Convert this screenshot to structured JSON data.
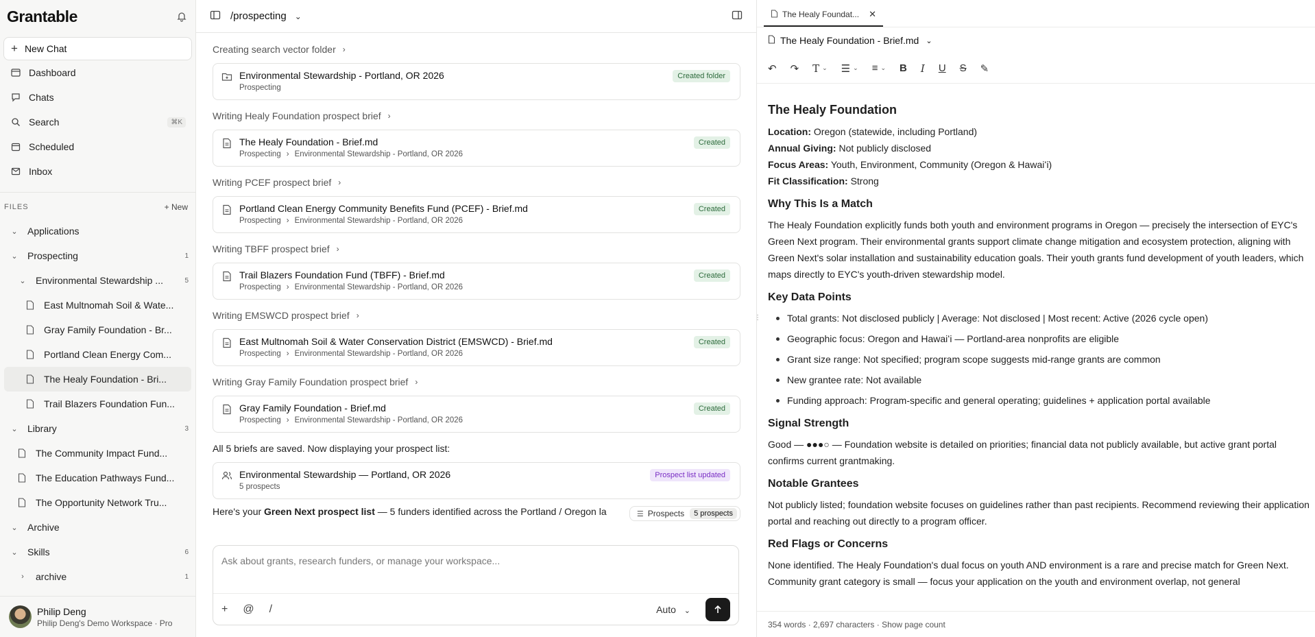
{
  "sidebar": {
    "logo": "Grantable",
    "new_chat": "New Chat",
    "nav": [
      {
        "label": "Dashboard",
        "icon": "dashboard-icon"
      },
      {
        "label": "Chats",
        "icon": "chat-icon"
      },
      {
        "label": "Search",
        "icon": "search-icon",
        "shortcut": "⌘K"
      },
      {
        "label": "Scheduled",
        "icon": "calendar-icon"
      },
      {
        "label": "Inbox",
        "icon": "inbox-icon"
      }
    ],
    "files_header": "FILES",
    "files_new": "New",
    "tree": [
      {
        "label": "Applications",
        "level": 0,
        "type": "folder",
        "expanded": true,
        "count": ""
      },
      {
        "label": "Prospecting",
        "level": 0,
        "type": "folder",
        "expanded": true,
        "count": "1"
      },
      {
        "label": "Environmental Stewardship ...",
        "level": 1,
        "type": "folder",
        "expanded": true,
        "count": "5"
      },
      {
        "label": "East Multnomah Soil & Wate...",
        "level": 2,
        "type": "file",
        "count": ""
      },
      {
        "label": "Gray Family Foundation - Br...",
        "level": 2,
        "type": "file",
        "count": ""
      },
      {
        "label": "Portland Clean Energy Com...",
        "level": 2,
        "type": "file",
        "count": ""
      },
      {
        "label": "The Healy Foundation - Bri...",
        "level": 2,
        "type": "file",
        "count": "",
        "selected": true
      },
      {
        "label": "Trail Blazers Foundation Fun...",
        "level": 2,
        "type": "file",
        "count": ""
      },
      {
        "label": "Library",
        "level": 0,
        "type": "folder",
        "expanded": true,
        "count": "3"
      },
      {
        "label": "The Community Impact Fund...",
        "level": 1,
        "type": "file",
        "count": ""
      },
      {
        "label": "The Education Pathways Fund...",
        "level": 1,
        "type": "file",
        "count": ""
      },
      {
        "label": "The Opportunity Network Tru...",
        "level": 1,
        "type": "file",
        "count": ""
      },
      {
        "label": "Archive",
        "level": 0,
        "type": "folder",
        "expanded": true,
        "count": ""
      },
      {
        "label": "Skills",
        "level": 0,
        "type": "folder",
        "expanded": true,
        "count": "6"
      },
      {
        "label": "archive",
        "level": 1,
        "type": "folder",
        "expanded": false,
        "count": "1"
      }
    ],
    "user": {
      "name": "Philip Deng",
      "sub": "Philip Deng's Demo Workspace · Pro"
    }
  },
  "chat": {
    "path": "/prospecting",
    "steps": [
      {
        "step": "Creating search vector folder",
        "title": "Environmental Stewardship - Portland, OR 2026",
        "crumbs": [
          "Prospecting"
        ],
        "badge": "Created folder",
        "icon": "folder-icon"
      },
      {
        "step": "Writing Healy Foundation prospect brief",
        "title": "The Healy Foundation - Brief.md",
        "crumbs": [
          "Prospecting",
          "Environmental Stewardship - Portland, OR 2026"
        ],
        "badge": "Created",
        "icon": "document-icon"
      },
      {
        "step": "Writing PCEF prospect brief",
        "title": "Portland Clean Energy Community Benefits Fund (PCEF) - Brief.md",
        "crumbs": [
          "Prospecting",
          "Environmental Stewardship - Portland, OR 2026"
        ],
        "badge": "Created",
        "icon": "document-icon"
      },
      {
        "step": "Writing TBFF prospect brief",
        "title": "Trail Blazers Foundation Fund (TBFF) - Brief.md",
        "crumbs": [
          "Prospecting",
          "Environmental Stewardship - Portland, OR 2026"
        ],
        "badge": "Created",
        "icon": "document-icon"
      },
      {
        "step": "Writing EMSWCD prospect brief",
        "title": "East Multnomah Soil & Water Conservation District (EMSWCD) - Brief.md",
        "crumbs": [
          "Prospecting",
          "Environmental Stewardship - Portland, OR 2026"
        ],
        "badge": "Created",
        "icon": "document-icon"
      },
      {
        "step": "Writing Gray Family Foundation prospect brief",
        "title": "Gray Family Foundation - Brief.md",
        "crumbs": [
          "Prospecting",
          "Environmental Stewardship - Portland, OR 2026"
        ],
        "badge": "Created",
        "icon": "document-icon"
      }
    ],
    "saved_msg": "All 5 briefs are saved. Now displaying your prospect list:",
    "list_card": {
      "title": "Environmental Stewardship — Portland, OR 2026",
      "sub": "5 prospects",
      "badge": "Prospect list updated"
    },
    "final_msg_pre": "Here's your ",
    "final_msg_bold": "Green Next prospect list",
    "final_msg_post": " — 5 funders identified across the Portland / Oregon la",
    "pill_label": "Prospects",
    "pill_count": "5 prospects",
    "composer_placeholder": "Ask about grants, research funders, or manage your workspace...",
    "model": "Auto"
  },
  "editor": {
    "tab": "The Healy Foundat...",
    "doc_title": "The Healy Foundation - Brief.md",
    "h1": "The Healy Foundation",
    "kv": [
      {
        "k": "Location:",
        "v": " Oregon (statewide, including Portland)"
      },
      {
        "k": "Annual Giving:",
        "v": " Not publicly disclosed"
      },
      {
        "k": "Focus Areas:",
        "v": " Youth, Environment, Community (Oregon & Hawaiʻi)"
      },
      {
        "k": "Fit Classification:",
        "v": " Strong"
      }
    ],
    "h_match": "Why This Is a Match",
    "p_match": "The Healy Foundation explicitly funds both youth and environment programs in Oregon — precisely the intersection of EYC's Green Next program. Their environmental grants support climate change mitigation and ecosystem protection, aligning with Green Next's solar installation and sustainability education goals. Their youth grants fund development of youth leaders, which maps directly to EYC's youth-driven stewardship model.",
    "h_data": "Key Data Points",
    "bullets": [
      "Total grants: Not disclosed publicly | Average: Not disclosed | Most recent: Active (2026 cycle open)",
      "Geographic focus: Oregon and Hawaiʻi — Portland-area nonprofits are eligible",
      "Grant size range: Not specified; program scope suggests mid-range grants are common",
      "New grantee rate: Not available",
      "Funding approach: Program-specific and general operating; guidelines + application portal available"
    ],
    "h_signal": "Signal Strength",
    "p_signal": "Good — ●●●○ — Foundation website is detailed on priorities; financial data not publicly available, but active grant portal confirms current grantmaking.",
    "h_grantees": "Notable Grantees",
    "p_grantees": "Not publicly listed; foundation website focuses on guidelines rather than past recipients. Recommend reviewing their application portal and reaching out directly to a program officer.",
    "h_flags": "Red Flags or Concerns",
    "p_flags": "None identified. The Healy Foundation's dual focus on youth AND environment is a rare and precise match for Green Next. Community grant category is small — focus your application on the youth and environment overlap, not general",
    "footer": "354 words · 2,697 characters · Show page count"
  }
}
